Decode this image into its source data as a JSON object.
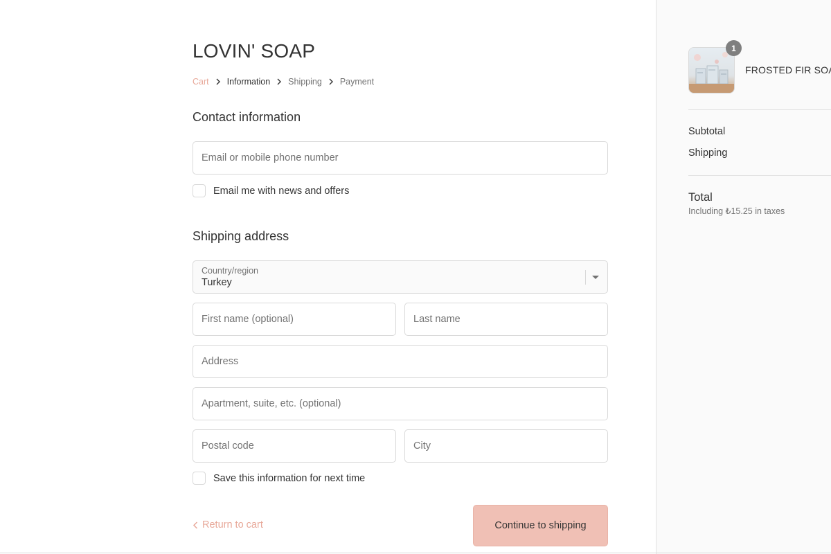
{
  "store": {
    "name": "LOVIN' SOAP"
  },
  "breadcrumb": [
    {
      "label": "Cart",
      "state": "link"
    },
    {
      "label": "Information",
      "state": "current"
    },
    {
      "label": "Shipping",
      "state": "upcoming"
    },
    {
      "label": "Payment",
      "state": "upcoming"
    }
  ],
  "contact": {
    "title": "Contact information",
    "email_placeholder": "Email or mobile phone number",
    "news_checkbox_label": "Email me with news and offers"
  },
  "shipping_address": {
    "title": "Shipping address",
    "country_label": "Country/region",
    "country_value": "Turkey",
    "first_name_placeholder": "First name (optional)",
    "last_name_placeholder": "Last name",
    "address_placeholder": "Address",
    "apartment_placeholder": "Apartment, suite, etc. (optional)",
    "postal_code_placeholder": "Postal code",
    "city_placeholder": "City",
    "save_info_label": "Save this information for next time"
  },
  "actions": {
    "return_label": "Return to cart",
    "continue_label": "Continue to shipping"
  },
  "order_summary": {
    "product_name": "FROSTED FIR SOAP",
    "quantity": "1",
    "subtotal_label": "Subtotal",
    "shipping_label": "Shipping",
    "total_label": "Total",
    "tax_note": "Including ₺15.25 in taxes"
  },
  "colors": {
    "accent": "#e8a99a",
    "button_bg": "#f0c0b5",
    "sidebar_bg": "#fafafa",
    "border": "#d9d9d9"
  },
  "icons": [
    "chevron-right-icon",
    "chevron-left-icon",
    "dropdown-arrow-icon"
  ]
}
